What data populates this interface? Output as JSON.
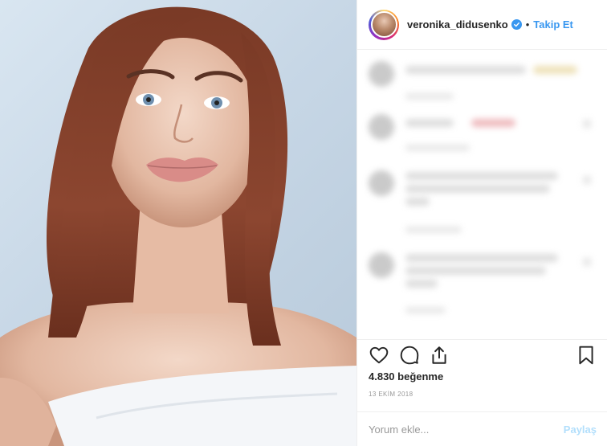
{
  "post": {
    "photo_alt": "portrait photo",
    "username": "veronika_didusenko",
    "separator": "•",
    "follow_label": "Takip Et",
    "likes": "4.830 beğenme",
    "date": "13 EKİM 2018"
  },
  "comment_box": {
    "placeholder": "Yorum ekle...",
    "post_label": "Paylaş"
  },
  "icons": [
    "heart-icon",
    "comment-icon",
    "share-icon",
    "bookmark-icon",
    "verified-badge-icon"
  ],
  "colors": {
    "link_blue": "#3897f0",
    "post_disabled": "#b2dffc",
    "text": "#262626",
    "muted": "#999999"
  }
}
